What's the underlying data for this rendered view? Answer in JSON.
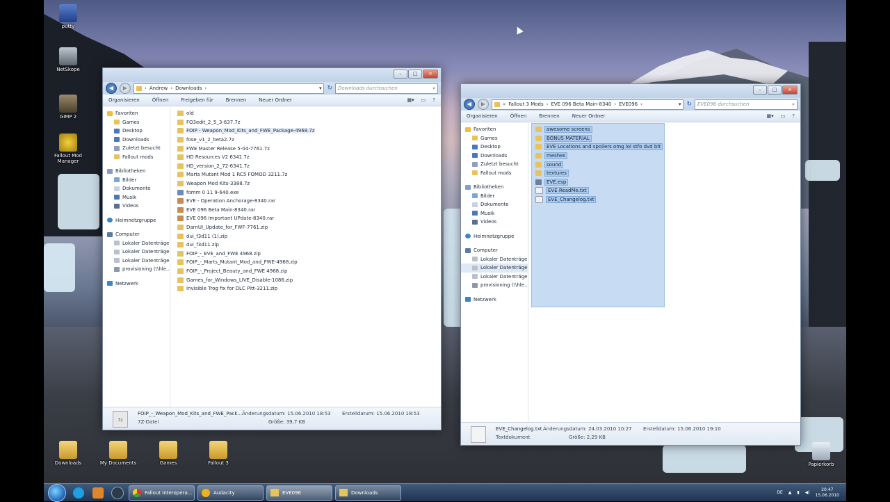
{
  "desktop": {
    "icons": [
      {
        "label": "putty"
      },
      {
        "label": "NetSkope"
      },
      {
        "label": "GIMP 2"
      },
      {
        "label": "Fallout Mod Manager"
      },
      {
        "label": "Downloads"
      },
      {
        "label": "My Documents"
      },
      {
        "label": "Games"
      },
      {
        "label": "Fallout 3"
      },
      {
        "label": "Papierkorb"
      }
    ]
  },
  "left_window": {
    "address": [
      "Andrew",
      "Downloads"
    ],
    "search_placeholder": "Downloads durchsuchen",
    "commands": [
      "Organisieren",
      "Öffnen",
      "Freigeben für",
      "Brennen",
      "Neuer Ordner"
    ],
    "nav": {
      "favorites_head": "Favoriten",
      "favorites": [
        "Games",
        "Desktop",
        "Downloads",
        "Zuletzt besucht",
        "Fallout mods"
      ],
      "libraries_head": "Bibliotheken",
      "libraries": [
        "Bilder",
        "Dokumente",
        "Musik",
        "Videos"
      ],
      "homegroup": "Heimnetzgruppe",
      "computer_head": "Computer",
      "computer": [
        "Lokaler Datenträger",
        "Lokaler Datenträger",
        "Lokaler Datenträger",
        "provisioning (\\\\hle..."
      ],
      "network": "Netzwerk"
    },
    "files": [
      "old",
      "FO3edit_2_5_3-637.7z",
      "FOIP - Weapon_Mod_Kits_and_FWE_Package-4968.7z",
      "fose_v1_2_beta2.7z",
      "FWE Master Release 5-04-7761.7z",
      "HD Resources V2 6341.7z",
      "HD_version_2_72-6341.7z",
      "Marts Mutant Mod 1 RC5 FOMOD 3211.7z",
      "Weapon Mod Kits-3388.7z",
      "fomm 0 11 9-640.exe",
      "EVE - Operation Anchorage-8340.rar",
      "EVE 096 Beta Main-8340.rar",
      "EVE 096 Important UPdate-8340.rar",
      "DarnUI_Update_for_FWF-7761.zip",
      "dui_f3d11 (1).zip",
      "dui_f3d11.zip",
      "FOIP_-_EVE_and_FWE 4968.zip",
      "FOIP_-_Marts_Mutant_Mod_and_FWE-4968.zip",
      "FOIP_-_Project_Beauty_and_FWE 4968.zip",
      "Games_for_Windows_LIVE_Disable-1086.zip",
      "Invisible Trog fix for DLC Pitt-3211.zip"
    ],
    "details": {
      "name": "FOIP_-_Weapon_Mod_Kits_and_FWE_Pack...",
      "type": "7Z-Datei",
      "modified": "Änderungsdatum: 15.06.2010 18:53",
      "size": "Größe: 39,7 KB",
      "created": "Erstelldatum: 15.06.2010 18:53",
      "icon_text": "7z"
    }
  },
  "right_window": {
    "address": [
      "Fallout 3 Mods",
      "EVE 096 Beta Main-8340",
      "EVE096"
    ],
    "search_placeholder": "EVE096 durchsuchen",
    "commands": [
      "Organisieren",
      "Öffnen",
      "Brennen",
      "Neuer Ordner"
    ],
    "nav": {
      "favorites_head": "Favoriten",
      "favorites": [
        "Games",
        "Desktop",
        "Downloads",
        "Zuletzt besucht",
        "Fallout mods"
      ],
      "libraries_head": "Bibliotheken",
      "libraries": [
        "Bilder",
        "Dokumente",
        "Musik",
        "Videos"
      ],
      "homegroup": "Heimnetzgruppe",
      "computer_head": "Computer",
      "computer": [
        "Lokaler Datenträger",
        "Lokaler Datenträger",
        "Lokaler Datenträger",
        "provisioning (\\\\hle..."
      ],
      "network": "Netzwerk"
    },
    "files": [
      "awesome screens",
      "BONUS MATERIAL",
      "EVE Locations and spoilers omg lol stfo dvd blt",
      "meshes",
      "sound",
      "textures",
      "EVE.esp",
      "EVE ReadMe.txt",
      "EVE_Changelog.txt"
    ],
    "details": {
      "name": "EVE_Changelog.txt",
      "type": "Textdokument",
      "modified": "Änderungsdatum: 24.03.2010 10:27",
      "size": "Größe: 2,29 KB",
      "created": "Erstelldatum: 15.06.2010 19:10"
    }
  },
  "taskbar": {
    "tasks": [
      "Fallout Interopera...",
      "Audacity",
      "EVE096",
      "Downloads"
    ],
    "lang": "DE",
    "time": "20:47",
    "date": "15.06.2010"
  },
  "colors": {
    "accent": "#3a6ea5",
    "selection": "#a9c9ee"
  }
}
